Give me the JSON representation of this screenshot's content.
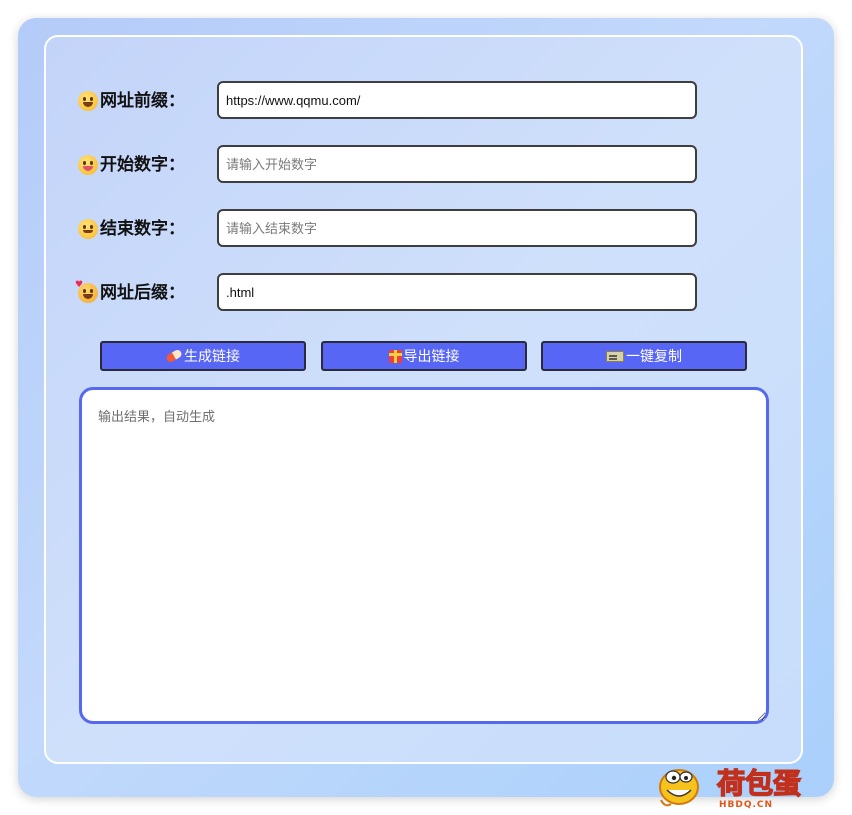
{
  "form": {
    "prefix": {
      "label": "网址前缀：",
      "emoji": "grinning-face-emoji",
      "value": "https://www.qqmu.com/",
      "placeholder": ""
    },
    "start": {
      "label": "开始数字：",
      "emoji": "tongue-face-emoji",
      "value": "",
      "placeholder": "请输入开始数字"
    },
    "end": {
      "label": "结束数字：",
      "emoji": "smiling-face-emoji",
      "value": "",
      "placeholder": "请输入结束数字"
    },
    "suffix": {
      "label": "网址后缀：",
      "emoji": "smiling-face-with-hearts-emoji",
      "value": ".html",
      "placeholder": ""
    }
  },
  "actions": {
    "generate": {
      "label": "生成链接",
      "icon": "pill-icon"
    },
    "export": {
      "label": "导出链接",
      "icon": "gift-icon"
    },
    "copy": {
      "label": "一键复制",
      "icon": "ticket-icon"
    }
  },
  "output": {
    "value": "",
    "placeholder": "输出结果，自动生成"
  },
  "watermark": {
    "brand": "荷包蛋",
    "domain": "HBDQ.CN"
  },
  "colors": {
    "accent": "#5766f5",
    "output_border": "#5568ee",
    "panel_border": "#ffffff"
  }
}
